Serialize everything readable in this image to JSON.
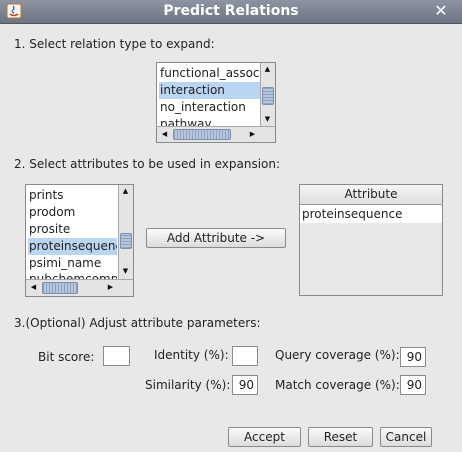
{
  "window": {
    "title": "Predict Relations",
    "close_glyph": "✕"
  },
  "section1": {
    "label": "1. Select relation type to expand:",
    "items": [
      {
        "label": "functional_associa",
        "selected": false
      },
      {
        "label": "interaction",
        "selected": true
      },
      {
        "label": "no_interaction",
        "selected": false
      },
      {
        "label": "pathway",
        "selected": false
      }
    ]
  },
  "section2": {
    "label": "2. Select attributes to be used in expansion:",
    "items": [
      {
        "label": "prints",
        "selected": false
      },
      {
        "label": "prodom",
        "selected": false
      },
      {
        "label": "prosite",
        "selected": false
      },
      {
        "label": "proteinsequence",
        "selected": true
      },
      {
        "label": "psimi_name",
        "selected": false
      },
      {
        "label": "pubchemcompo",
        "selected": false
      }
    ],
    "add_button": "Add Attribute ->",
    "table": {
      "header": "Attribute",
      "rows": [
        "proteinsequence"
      ]
    }
  },
  "section3": {
    "label": "3.(Optional) Adjust attribute parameters:",
    "bit_score": {
      "label": "Bit score:",
      "value": ""
    },
    "identity": {
      "label": "Identity (%):",
      "value": ""
    },
    "query_coverage": {
      "label": "Query coverage (%):",
      "value": "90"
    },
    "similarity": {
      "label": "Similarity (%):",
      "value": "90"
    },
    "match_coverage": {
      "label": "Match coverage (%):",
      "value": "90"
    }
  },
  "buttons": {
    "accept": "Accept",
    "reset": "Reset",
    "cancel": "Cancel"
  }
}
